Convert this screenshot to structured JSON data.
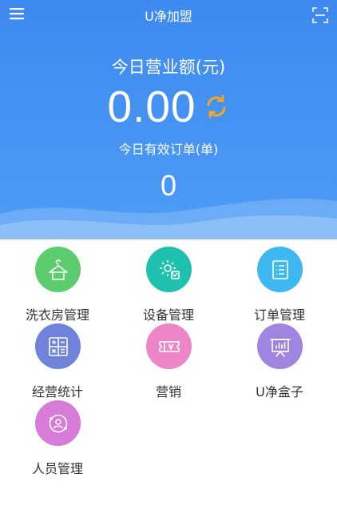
{
  "app": {
    "title": "U净加盟"
  },
  "header": {
    "menu_icon": "hamburger-menu-icon",
    "scan_icon": "scan-frame-icon",
    "revenue_label": "今日营业额(元)",
    "revenue_value": "0.00",
    "refresh_icon": "refresh-icon",
    "orders_label": "今日有效订单(单)",
    "orders_value": "0"
  },
  "colors": {
    "header_blue": "#4592f2",
    "refresh_orange": "#f5a623",
    "laundry_green": "#5ccc6e",
    "device_teal": "#20c0ae",
    "order_blue": "#3fb8f2",
    "stats_indigo": "#6f83db",
    "marketing_pink": "#ec86c6",
    "box_purple": "#a085e0",
    "staff_magenta": "#d77bd8"
  },
  "menu": {
    "items": [
      {
        "label": "洗衣房管理",
        "icon": "hanger-icon"
      },
      {
        "label": "设备管理",
        "icon": "device-settings-icon"
      },
      {
        "label": "订单管理",
        "icon": "order-list-icon"
      },
      {
        "label": "经营统计",
        "icon": "calculator-icon"
      },
      {
        "label": "营销",
        "icon": "coupon-icon"
      },
      {
        "label": "U净盒子",
        "icon": "presentation-board-icon"
      },
      {
        "label": "人员管理",
        "icon": "staff-circle-icon"
      }
    ]
  }
}
